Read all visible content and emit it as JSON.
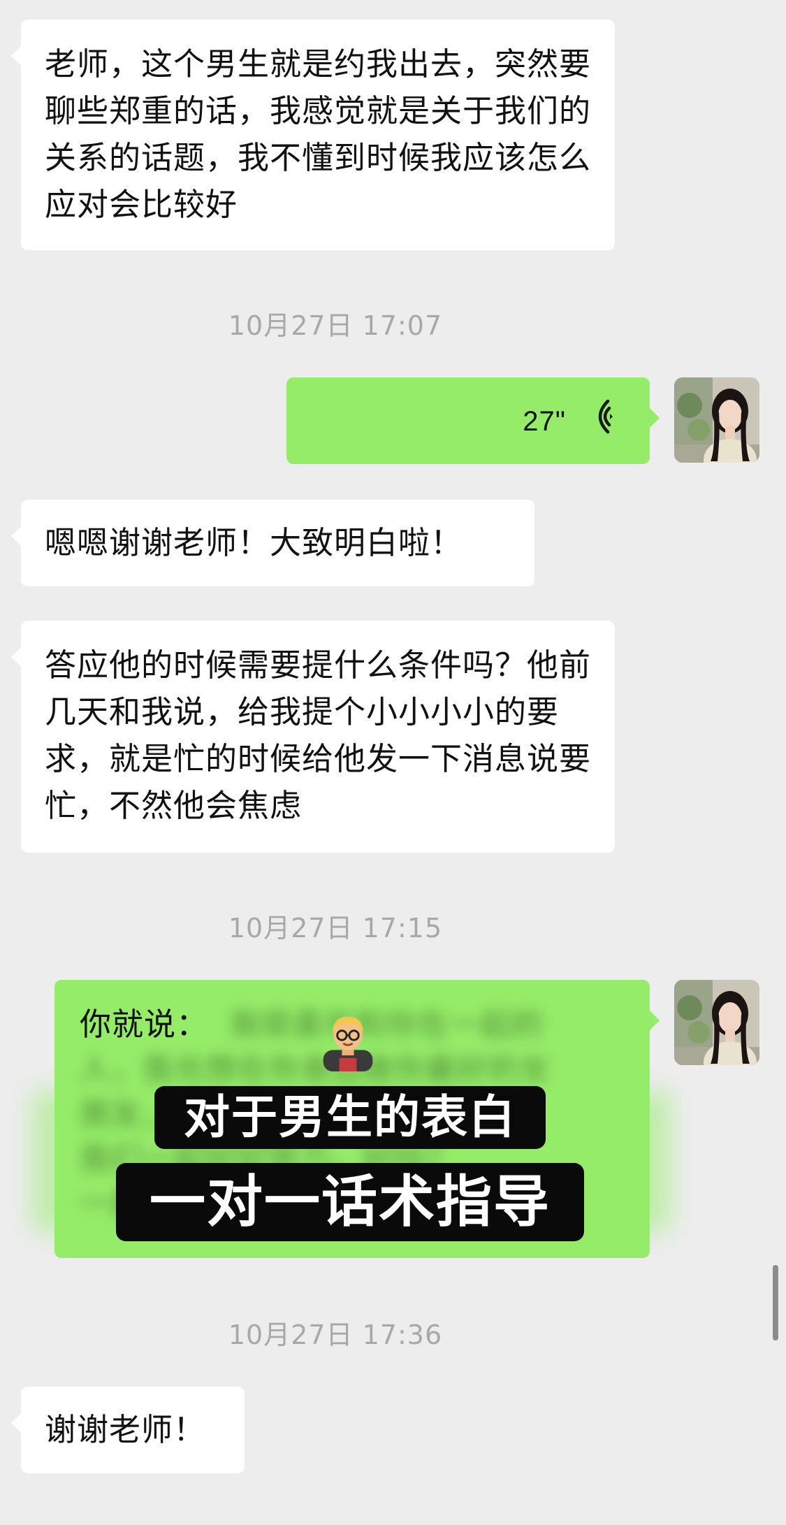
{
  "messages": {
    "m1": "老师，这个男生就是约我出去，突然要聊些郑重的话，我感觉就是关于我们的关系的话题，我不懂到时候我应该怎么应对会比较好",
    "t1": "10月27日 17:07",
    "voice_duration": "27\"",
    "m2": "嗯嗯谢谢老师！大致明白啦！",
    "m3": "答应他的时候需要提什么条件吗？他前几天和我说，给我提个小小小小的要求，就是忙的时候给他发一下消息说要忙，不然他会焦虑",
    "t2": "10月27日 17:15",
    "reply_prefix": "你就说：",
    "overlay_line1": "对于男生的表白",
    "overlay_line2": "一对一话术指导",
    "t3": "10月27日 17:36",
    "m4": "谢谢老师！"
  },
  "blurred_reply": {
    "line1": "我很喜欢和你在一起的",
    "line2": "人，我也想在你身边做你最好的女",
    "line3": "朋友，我很愿意和你在一起，",
    "line4": "我们一起好好努力，好吗？",
    "line5": "一起"
  },
  "colors": {
    "background": "#ededed",
    "incoming_bubble": "#ffffff",
    "outgoing_bubble": "#95ec69",
    "timestamp_text": "#a8a8a8",
    "overlay_bg": "#0a0a0a",
    "overlay_text": "#ffffff"
  },
  "icons": {
    "voice": "voice-wave-icon",
    "teacher_emoji": "teacher-emoji-icon",
    "avatar": "user-avatar"
  }
}
